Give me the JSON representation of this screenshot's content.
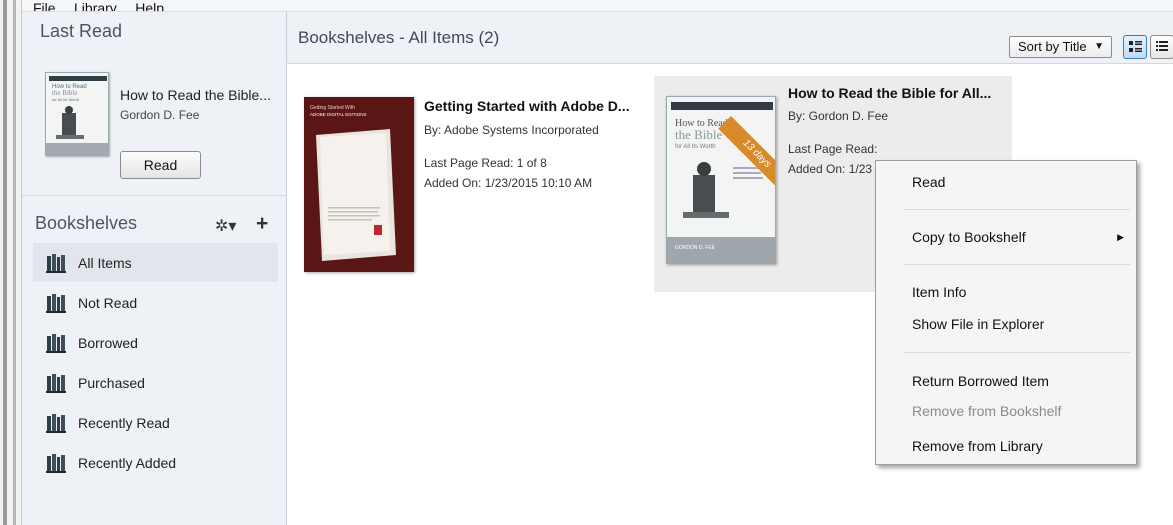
{
  "menu": [
    "File",
    "Library",
    "Help"
  ],
  "sidebar": {
    "last_read_title": "Last Read",
    "last_read": {
      "title": "How to Read the Bible...",
      "author": "Gordon D. Fee",
      "read_button": "Read",
      "cover_lines": [
        "How to Read",
        "the Bible",
        "for All Its Worth"
      ]
    },
    "bookshelves_title": "Bookshelves",
    "gear_icon": "gear-icon",
    "add_icon": "plus-icon",
    "shelves": [
      {
        "label": "All Items",
        "selected": true
      },
      {
        "label": "Not Read",
        "selected": false
      },
      {
        "label": "Borrowed",
        "selected": false
      },
      {
        "label": "Purchased",
        "selected": false
      },
      {
        "label": "Recently Read",
        "selected": false
      },
      {
        "label": "Recently Added",
        "selected": false
      }
    ]
  },
  "main": {
    "title": "Bookshelves - All Items (2)",
    "sort_label": "Sort by Title",
    "books": [
      {
        "title": "Getting Started with Adobe D...",
        "author": "By:  Adobe Systems Incorporated",
        "last_page": "Last Page Read:  1 of 8",
        "added_on": "Added On:  1/23/2015 10:10 AM",
        "cover_header": "Getting Started With",
        "cover_sub": "ADOBE DIGITAL EDITIONS"
      },
      {
        "title": "How to Read the Bible for All...",
        "author": "By:  Gordon D. Fee",
        "last_page": "Last Page Read:",
        "added_on": "Added On:  1/23",
        "ribbon": "13 days",
        "cover_lines": [
          "How to Read",
          "the Bible",
          "for All Its Worth"
        ],
        "cover_authors": "GORDON D. FEE"
      }
    ]
  },
  "context_menu": {
    "items": [
      {
        "label": "Read",
        "disabled": false
      },
      {
        "label": "Copy to Bookshelf",
        "disabled": false,
        "submenu": true
      },
      {
        "label": "Item Info",
        "disabled": false
      },
      {
        "label": "Show File in Explorer",
        "disabled": false
      },
      {
        "label": "Return Borrowed Item",
        "disabled": false
      },
      {
        "label": "Remove from Bookshelf",
        "disabled": true
      },
      {
        "label": "Remove from Library",
        "disabled": false
      }
    ]
  },
  "colors": {
    "sidebar_bg": "#eef1f6",
    "ribbon": "#d98a2b",
    "adobe_cover": "#5a1414"
  }
}
